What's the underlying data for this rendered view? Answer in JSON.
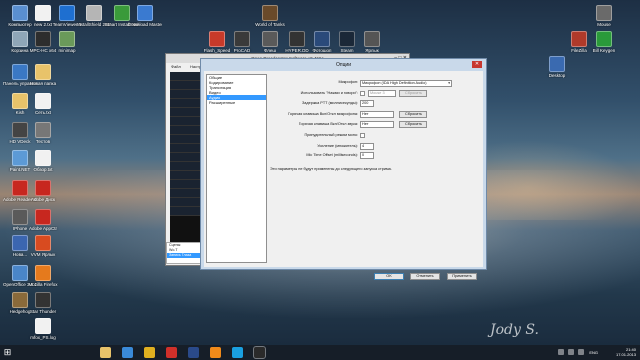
{
  "desktop": {
    "icons": [
      {
        "label": "Компьютер",
        "color": "#5a8fd0"
      },
      {
        "label": "Корзина",
        "color": "#8fa6b8"
      },
      {
        "label": "Панель управления",
        "color": "#3a78c4"
      },
      {
        "label": "Kish",
        "color": "#e8c36a"
      },
      {
        "label": "HD VDeck",
        "color": "#444444"
      },
      {
        "label": "Paint.NET",
        "color": "#5c9ad6"
      },
      {
        "label": "Adobe Reader XI",
        "color": "#c7271f"
      },
      {
        "label": "IPhone",
        "color": "#5a5a5a"
      },
      {
        "label": "Нова...",
        "color": "#3b66b0"
      },
      {
        "label": "OpenOffice 3.4.1",
        "color": "#4a86c8"
      },
      {
        "label": "Hedgehog",
        "color": "#8a6a3a"
      },
      {
        "label": "new 2.txt",
        "color": "#f1f1f1"
      },
      {
        "label": "MPC-HC x64",
        "color": "#2d2d2d"
      },
      {
        "label": "Новая папка",
        "color": "#e8c36a"
      },
      {
        "label": "Сеть.txt",
        "color": "#f1f1f1"
      },
      {
        "label": "Тестов",
        "color": "#777777"
      },
      {
        "label": "Обзор.txt",
        "color": "#f1f1f1"
      },
      {
        "label": "Adobe Диск",
        "color": "#c7271f"
      },
      {
        "label": "Adobe AppCtr",
        "color": "#c7271f"
      },
      {
        "label": "VVM Ярлык",
        "color": "#d84b20"
      },
      {
        "label": "Mozilla Firefox",
        "color": "#e57a1d"
      },
      {
        "label": "Star Thunder",
        "color": "#333333"
      },
      {
        "label": "mfox_PS.log",
        "color": "#f1f1f1"
      },
      {
        "label": "TeamViewer 8",
        "color": "#1e6fd0"
      },
      {
        "label": "minimap",
        "color": "#6a9a5a"
      },
      {
        "label": "InstallShield 2010",
        "color": "#b5b5b5"
      },
      {
        "label": "Smart Install Maker",
        "color": "#3a9a3a"
      },
      {
        "label": "Download Master",
        "color": "#3a7ad0"
      },
      {
        "label": "World of Tanks",
        "color": "#6a4a2a"
      },
      {
        "label": "Flash_Speed",
        "color": "#c83a2a"
      },
      {
        "label": "ProCAD",
        "color": "#3a3a3a"
      },
      {
        "label": "Флеш",
        "color": "#5a5a5a"
      },
      {
        "label": "HYPER.DD",
        "color": "#333333"
      },
      {
        "label": "Фотошоп",
        "color": "#2a4a7a"
      },
      {
        "label": "Steam",
        "color": "#1b2838"
      },
      {
        "label": "Ярлык",
        "color": "#555555"
      },
      {
        "label": "Desktop",
        "color": "#3a6ab0"
      },
      {
        "label": "Mouse",
        "color": "#6a6a6a"
      },
      {
        "label": "FileZilla",
        "color": "#b03a2a"
      },
      {
        "label": "Bill Keygen",
        "color": "#2a9a3a"
      }
    ]
  },
  "obs": {
    "title": "Open Broadcaster Software v0.466a",
    "menu": [
      "Файл",
      "Настройки"
    ],
    "window_controls": "–  □  ✕",
    "scenes_label": "Сцены:",
    "scenes": [
      "Wo.T",
      "Запись Глаза"
    ]
  },
  "dialog": {
    "title": "Опции",
    "close_label": "✕",
    "categories": [
      "Общие",
      "Кодирование",
      "Трансляция",
      "Видео",
      "Аудио",
      "Расширенные"
    ],
    "selected_category": "Аудио",
    "fields": {
      "microphone_label": "Микрофон:",
      "microphone_value": "Микрофон (IDA High Definition Audio)",
      "ptt_label": "Использовать \"Нажми и говори\":",
      "ptt_key_value": "Mouse 3",
      "ptt_reset": "Сбросить",
      "ptt_delay_label": "Задержка PTT (миллисекунды):",
      "ptt_delay_value": "200",
      "mute_mic_hotkey_label": "Горячая клавиша Вкл/Откл микрофона:",
      "mute_mic_hotkey_value": "Нет",
      "mute_mic_reset": "Сбросить",
      "mute_desktop_hotkey_label": "Горячая клавиша Вкл/Откл звука:",
      "mute_desktop_hotkey_value": "Нет",
      "mute_desktop_reset": "Сбросить",
      "force_mono_label": "Принудительный режим моно:",
      "mic_boost_label": "Усиление (множитель):",
      "mic_boost_value": "4",
      "mic_offset_label": "Mic Time Offset (milliseconds):",
      "mic_offset_value": "0",
      "note": "Эти параметры не будут применены до следующего запуска стрима."
    },
    "buttons": {
      "ok": "OK",
      "cancel": "Отменить",
      "apply": "Применить"
    }
  },
  "taskbar": {
    "start_glyph": "⊞",
    "apps": [
      {
        "name": "explorer",
        "color": "#e8c36a"
      },
      {
        "name": "ie",
        "color": "#3a8ad8"
      },
      {
        "name": "chrome",
        "color": "#e0b020"
      },
      {
        "name": "opera",
        "color": "#d0302a"
      },
      {
        "name": "photoshop",
        "color": "#2a4a8a"
      },
      {
        "name": "vlc",
        "color": "#f08a1a"
      },
      {
        "name": "skype",
        "color": "#1aa0e0"
      },
      {
        "name": "obs",
        "color": "#2a2a2a"
      }
    ],
    "language": "ENG",
    "time": "21:40",
    "date": "17.01.2013"
  },
  "signature_text": "Jody S."
}
